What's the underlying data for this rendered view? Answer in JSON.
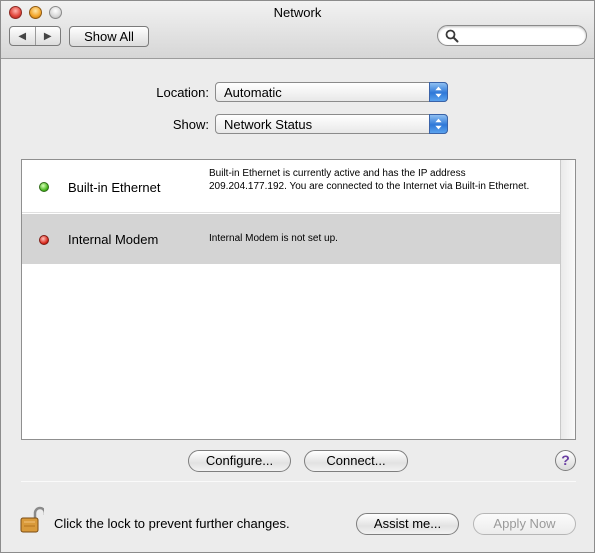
{
  "window": {
    "title": "Network"
  },
  "toolbar": {
    "back_glyph": "◀",
    "forward_glyph": "▶",
    "show_all_label": "Show All",
    "search_value": "",
    "search_placeholder": ""
  },
  "location": {
    "label": "Location:",
    "value": "Automatic"
  },
  "show": {
    "label": "Show:",
    "value": "Network Status"
  },
  "services": [
    {
      "name": "Built-in Ethernet",
      "status": "active",
      "status_color": "#44b51a",
      "description": "Built-in Ethernet is currently active and has the IP address 209.204.177.192. You are connected to the Internet via Built-in Ethernet."
    },
    {
      "name": "Internal Modem",
      "status": "not-set-up",
      "status_color": "#d8261a",
      "description": "Internal Modem is not set up."
    }
  ],
  "actions": {
    "configure_label": "Configure...",
    "connect_label": "Connect...",
    "help_label": "?"
  },
  "footer": {
    "lock_message": "Click the lock to prevent further changes.",
    "assist_label": "Assist me...",
    "apply_label": "Apply Now"
  },
  "icons": {
    "close": "close-icon",
    "minimize": "minimize-icon",
    "zoom": "zoom-icon",
    "search": "search-icon",
    "lock": "lock-icon",
    "popup_arrows": "chevron-updown-icon"
  }
}
